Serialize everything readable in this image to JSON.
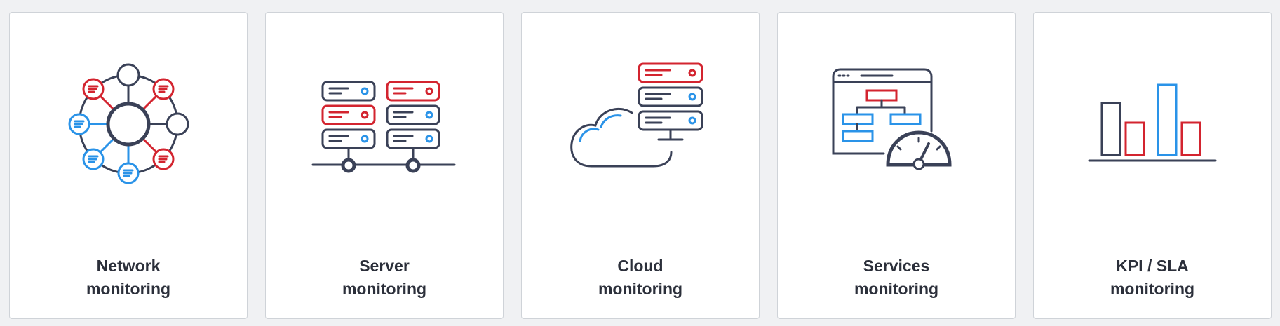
{
  "colors": {
    "navy": "#3a4157",
    "red": "#d3242f",
    "blue": "#2a93e8"
  },
  "cards": [
    {
      "id": "network",
      "icon": "network-graph-icon",
      "title_line1": "Network",
      "title_line2": "monitoring"
    },
    {
      "id": "server",
      "icon": "server-rack-icon",
      "title_line1": "Server",
      "title_line2": "monitoring"
    },
    {
      "id": "cloud",
      "icon": "cloud-server-icon",
      "title_line1": "Cloud",
      "title_line2": "monitoring"
    },
    {
      "id": "services",
      "icon": "services-gauge-icon",
      "title_line1": "Services",
      "title_line2": "monitoring"
    },
    {
      "id": "kpi",
      "icon": "bar-chart-icon",
      "title_line1": "KPI / SLA",
      "title_line2": "monitoring"
    }
  ]
}
